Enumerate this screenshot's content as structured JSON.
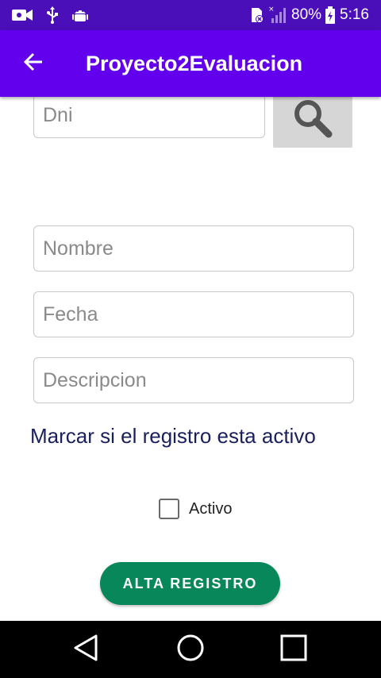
{
  "status_bar": {
    "battery": "80%",
    "time": "5:16",
    "left_icons": [
      "video-call-icon",
      "usb-icon",
      "android-debug-icon"
    ],
    "right_icons": [
      "sim-card-icon",
      "signal-icon",
      "battery-icon"
    ]
  },
  "app_bar": {
    "title": "Proyecto2Evaluacion",
    "back_icon": "arrow-back-icon"
  },
  "form": {
    "dni": {
      "placeholder": "Dni",
      "value": ""
    },
    "search_icon": "search-icon",
    "nombre": {
      "placeholder": "Nombre",
      "value": ""
    },
    "fecha": {
      "placeholder": "Fecha",
      "value": ""
    },
    "descripcion": {
      "placeholder": "Descripcion",
      "value": ""
    },
    "instruction": "Marcar si el registro esta activo",
    "checkbox": {
      "label": "Activo",
      "checked": false
    },
    "submit_label": "ALTA REGISTRO"
  },
  "navigation": {
    "buttons": [
      "back-triangle-icon",
      "home-circle-icon",
      "recents-square-icon"
    ]
  },
  "colors": {
    "status_bar": "#4a0fb8",
    "app_bar": "#6200ee",
    "submit_button": "#08875a",
    "instruction_text": "#1a1f5e",
    "search_button_bg": "#d6d6d6"
  }
}
